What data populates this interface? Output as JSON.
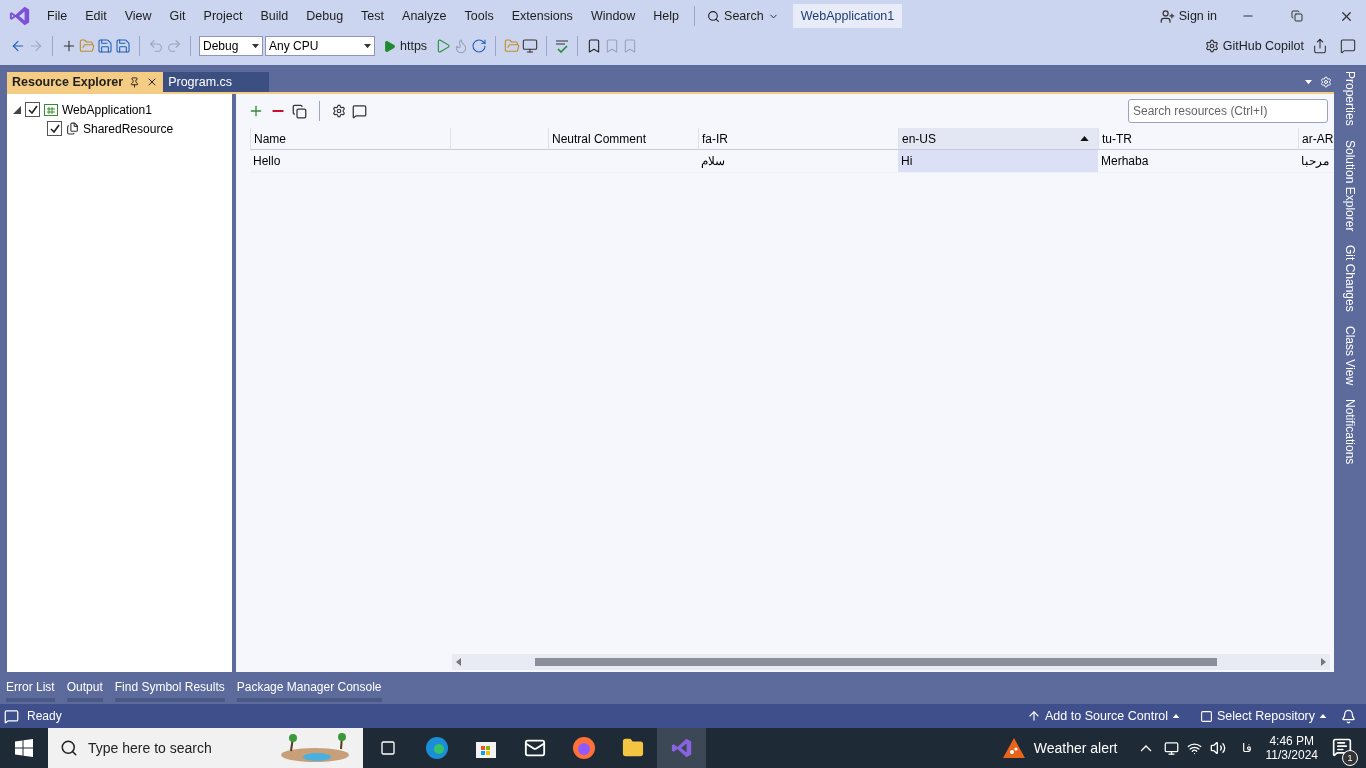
{
  "title_bar": {
    "menu": [
      "File",
      "Edit",
      "View",
      "Git",
      "Project",
      "Build",
      "Debug",
      "Test",
      "Analyze",
      "Tools",
      "Extensions",
      "Window",
      "Help"
    ],
    "search": "Search",
    "solution": "WebApplication1",
    "sign_in": "Sign in"
  },
  "toolbar": {
    "configuration": "Debug",
    "platform": "Any CPU",
    "run_target": "https",
    "copilot": "GitHub Copilot"
  },
  "document_tabs": [
    {
      "label": "Resource Explorer",
      "selected": true
    },
    {
      "label": "Program.cs",
      "selected": false
    }
  ],
  "tree": [
    {
      "label": "WebApplication1",
      "checked": true,
      "expanded": true,
      "children": [
        {
          "label": "SharedResource",
          "checked": true
        }
      ]
    }
  ],
  "search_resources": {
    "placeholder": "Search resources (Ctrl+I)"
  },
  "table": {
    "columns": [
      {
        "label": "Name",
        "sorted": false
      },
      {
        "sorted": false
      },
      {
        "label": "Neutral Comment",
        "sorted": false
      },
      {
        "label": "fa-IR",
        "sorted": false
      },
      {
        "label": "en-US",
        "sorted": true
      },
      {
        "label": "tu-TR",
        "sorted": false
      },
      {
        "label": "ar-AR",
        "sorted": false
      }
    ],
    "rows": [
      {
        "cells": [
          {
            "text": "Hello",
            "selected": false
          },
          {
            "selected": false
          },
          {
            "selected": false
          },
          {
            "text": "سلام",
            "selected": false
          },
          {
            "text": "Hi",
            "selected": true
          },
          {
            "text": "Merhaba",
            "selected": false
          },
          {
            "text": "مرحبا",
            "selected": false
          }
        ]
      }
    ]
  },
  "side_tabs": [
    "Properties",
    "Solution Explorer",
    "Git Changes",
    "Class View",
    "Notifications"
  ],
  "tool_tabs": [
    "Error List",
    "Output",
    "Find Symbol Results",
    "Package Manager Console"
  ],
  "status_bar": {
    "status": "Ready",
    "source_control": "Add to Source Control",
    "repository": "Select Repository"
  },
  "taskbar": {
    "search_placeholder": "Type here to search",
    "weather": "Weather alert",
    "language": "فا",
    "time": "4:46 PM",
    "date": "11/3/2024",
    "notifications": "1"
  }
}
